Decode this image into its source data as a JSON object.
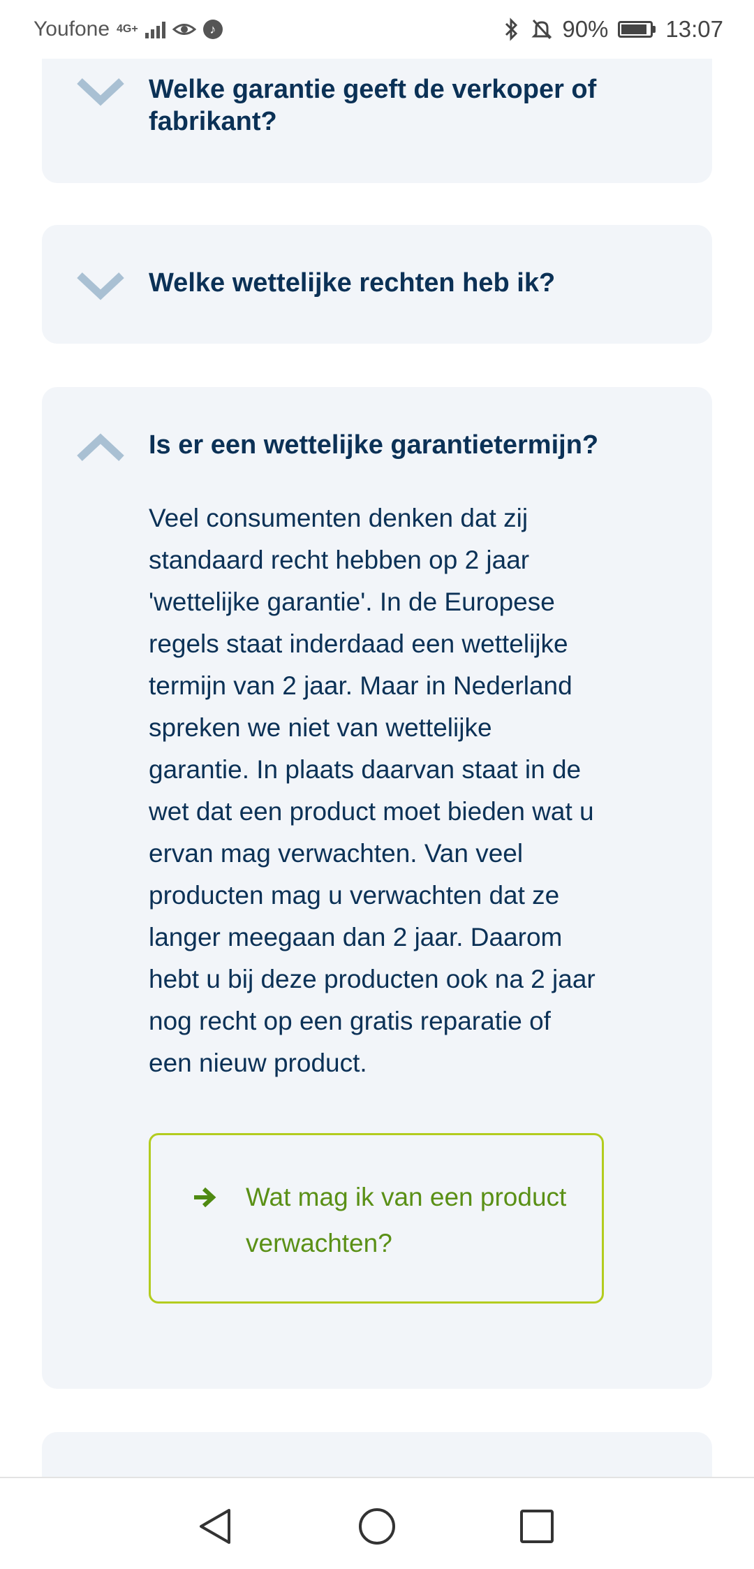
{
  "status_bar": {
    "carrier": "Youfone",
    "network": "4G+",
    "battery": "90%",
    "time": "13:07",
    "battery_level": 0.9
  },
  "faq": {
    "items": [
      {
        "title": "Welke garantie geeft de verkoper of fabrikant?",
        "expanded": false
      },
      {
        "title": "Welke wettelijke rechten heb ik?",
        "expanded": false
      },
      {
        "title": "Is er een wettelijke garantietermijn?",
        "expanded": true,
        "body": "Veel consumenten denken dat zij standaard recht hebben op 2 jaar 'wettelijke garantie'. In de Europese regels staat inderdaad een wettelijke termijn van 2 jaar. Maar in Nederland spreken we niet van wettelijke garantie. In plaats daarvan staat in de wet dat een product moet bieden wat u ervan mag verwachten. Van veel producten mag u verwachten dat ze langer meegaan dan 2 jaar. Daarom hebt u bij deze producten ook na 2 jaar nog recht op een gratis reparatie of een nieuw product.",
        "link_label": "Wat mag ik van een product verwachten?"
      }
    ]
  },
  "colors": {
    "card_bg": "#f2f5f9",
    "title_text": "#0b3156",
    "chevron": "#a9c0d3",
    "link_border": "#b3cc1f",
    "link_text": "#5a9016",
    "arrow": "#4f8a12"
  },
  "icons": {
    "collapsed": "chevron-down-icon",
    "expanded": "chevron-up-icon",
    "link": "arrow-right-icon",
    "nav": [
      "back-triangle-icon",
      "home-circle-icon",
      "recents-square-icon"
    ]
  }
}
